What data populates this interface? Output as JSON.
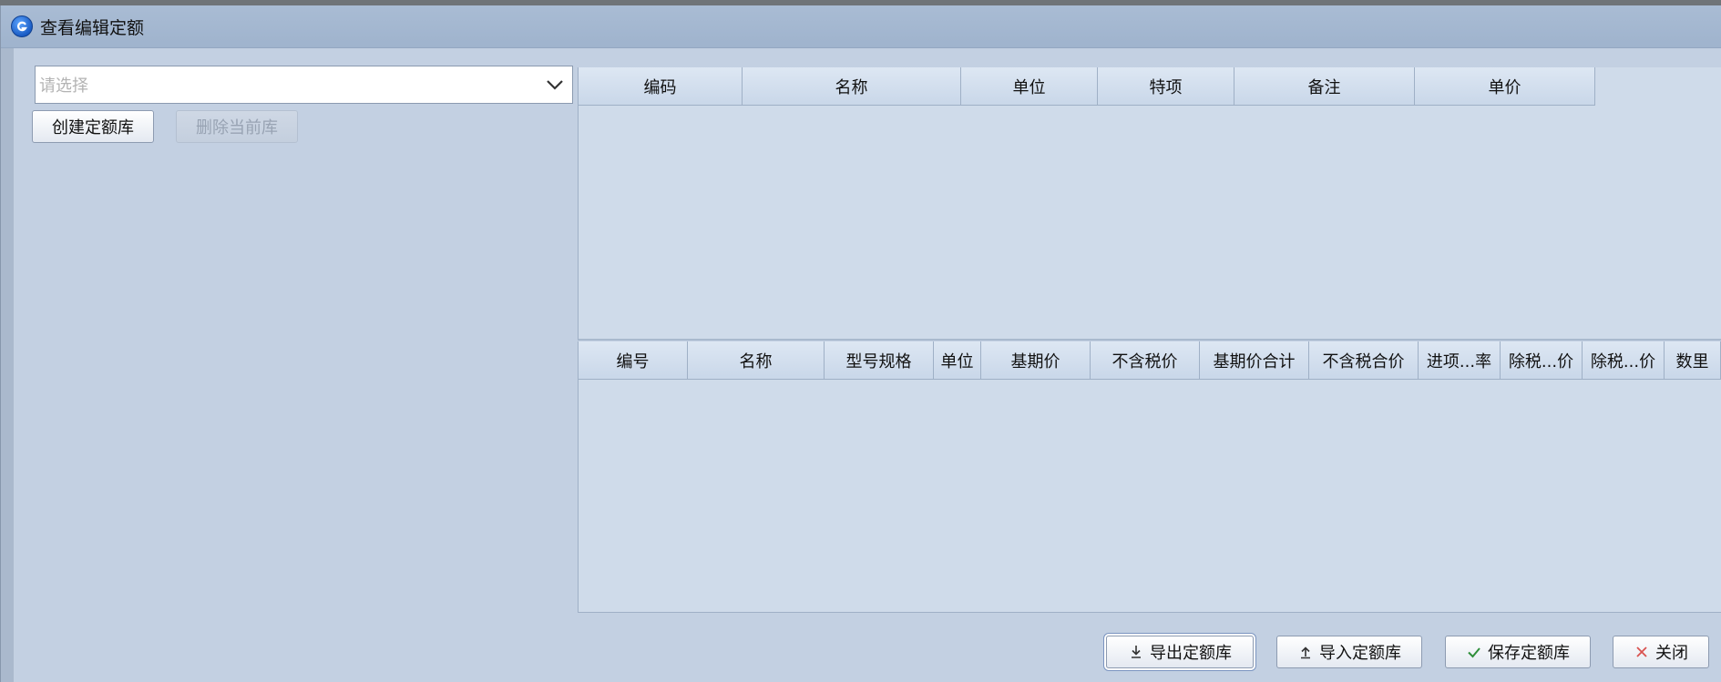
{
  "dialog": {
    "title": "查看编辑定额",
    "icon": "app-logo-icon"
  },
  "left_panel": {
    "select": {
      "placeholder": "请选择",
      "value": ""
    },
    "create_button": "创建定额库",
    "delete_button": "删除当前库"
  },
  "quota_table": {
    "columns": [
      "编码",
      "名称",
      "单位",
      "特项",
      "备注",
      "单价"
    ],
    "rows": []
  },
  "resource_table": {
    "columns": [
      "编号",
      "名称",
      "型号规格",
      "单位",
      "基期价",
      "不含税价",
      "基期价合计",
      "不含税合价",
      "进项...率",
      "除税...价",
      "除税...价",
      "数里"
    ],
    "rows": []
  },
  "footer": {
    "export_button": "导出定额库",
    "import_button": "导入定额库",
    "save_button": "保存定额库",
    "close_button": "关闭"
  },
  "colors": {
    "dialog_bg": "#c3d0e2",
    "titlebar": "#a9bcd4",
    "grid_bg": "#cfdbea",
    "close_x": "#d9534f",
    "save_check": "#2f8f3a"
  }
}
